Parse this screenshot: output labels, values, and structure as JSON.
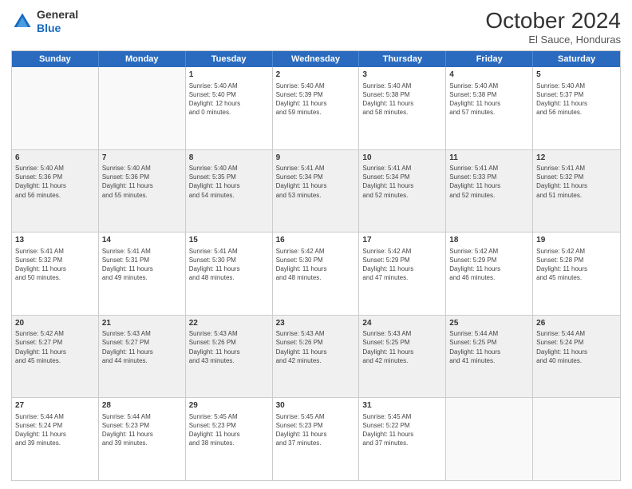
{
  "header": {
    "logo": {
      "general": "General",
      "blue": "Blue"
    },
    "month": "October 2024",
    "location": "El Sauce, Honduras"
  },
  "weekdays": [
    "Sunday",
    "Monday",
    "Tuesday",
    "Wednesday",
    "Thursday",
    "Friday",
    "Saturday"
  ],
  "rows": [
    [
      {
        "day": "",
        "info": "",
        "empty": true
      },
      {
        "day": "",
        "info": "",
        "empty": true
      },
      {
        "day": "1",
        "info": "Sunrise: 5:40 AM\nSunset: 5:40 PM\nDaylight: 12 hours\nand 0 minutes."
      },
      {
        "day": "2",
        "info": "Sunrise: 5:40 AM\nSunset: 5:39 PM\nDaylight: 11 hours\nand 59 minutes."
      },
      {
        "day": "3",
        "info": "Sunrise: 5:40 AM\nSunset: 5:38 PM\nDaylight: 11 hours\nand 58 minutes."
      },
      {
        "day": "4",
        "info": "Sunrise: 5:40 AM\nSunset: 5:38 PM\nDaylight: 11 hours\nand 57 minutes."
      },
      {
        "day": "5",
        "info": "Sunrise: 5:40 AM\nSunset: 5:37 PM\nDaylight: 11 hours\nand 56 minutes."
      }
    ],
    [
      {
        "day": "6",
        "info": "Sunrise: 5:40 AM\nSunset: 5:36 PM\nDaylight: 11 hours\nand 56 minutes.",
        "shaded": true
      },
      {
        "day": "7",
        "info": "Sunrise: 5:40 AM\nSunset: 5:36 PM\nDaylight: 11 hours\nand 55 minutes.",
        "shaded": true
      },
      {
        "day": "8",
        "info": "Sunrise: 5:40 AM\nSunset: 5:35 PM\nDaylight: 11 hours\nand 54 minutes.",
        "shaded": true
      },
      {
        "day": "9",
        "info": "Sunrise: 5:41 AM\nSunset: 5:34 PM\nDaylight: 11 hours\nand 53 minutes.",
        "shaded": true
      },
      {
        "day": "10",
        "info": "Sunrise: 5:41 AM\nSunset: 5:34 PM\nDaylight: 11 hours\nand 52 minutes.",
        "shaded": true
      },
      {
        "day": "11",
        "info": "Sunrise: 5:41 AM\nSunset: 5:33 PM\nDaylight: 11 hours\nand 52 minutes.",
        "shaded": true
      },
      {
        "day": "12",
        "info": "Sunrise: 5:41 AM\nSunset: 5:32 PM\nDaylight: 11 hours\nand 51 minutes.",
        "shaded": true
      }
    ],
    [
      {
        "day": "13",
        "info": "Sunrise: 5:41 AM\nSunset: 5:32 PM\nDaylight: 11 hours\nand 50 minutes."
      },
      {
        "day": "14",
        "info": "Sunrise: 5:41 AM\nSunset: 5:31 PM\nDaylight: 11 hours\nand 49 minutes."
      },
      {
        "day": "15",
        "info": "Sunrise: 5:41 AM\nSunset: 5:30 PM\nDaylight: 11 hours\nand 48 minutes."
      },
      {
        "day": "16",
        "info": "Sunrise: 5:42 AM\nSunset: 5:30 PM\nDaylight: 11 hours\nand 48 minutes."
      },
      {
        "day": "17",
        "info": "Sunrise: 5:42 AM\nSunset: 5:29 PM\nDaylight: 11 hours\nand 47 minutes."
      },
      {
        "day": "18",
        "info": "Sunrise: 5:42 AM\nSunset: 5:29 PM\nDaylight: 11 hours\nand 46 minutes."
      },
      {
        "day": "19",
        "info": "Sunrise: 5:42 AM\nSunset: 5:28 PM\nDaylight: 11 hours\nand 45 minutes."
      }
    ],
    [
      {
        "day": "20",
        "info": "Sunrise: 5:42 AM\nSunset: 5:27 PM\nDaylight: 11 hours\nand 45 minutes.",
        "shaded": true
      },
      {
        "day": "21",
        "info": "Sunrise: 5:43 AM\nSunset: 5:27 PM\nDaylight: 11 hours\nand 44 minutes.",
        "shaded": true
      },
      {
        "day": "22",
        "info": "Sunrise: 5:43 AM\nSunset: 5:26 PM\nDaylight: 11 hours\nand 43 minutes.",
        "shaded": true
      },
      {
        "day": "23",
        "info": "Sunrise: 5:43 AM\nSunset: 5:26 PM\nDaylight: 11 hours\nand 42 minutes.",
        "shaded": true
      },
      {
        "day": "24",
        "info": "Sunrise: 5:43 AM\nSunset: 5:25 PM\nDaylight: 11 hours\nand 42 minutes.",
        "shaded": true
      },
      {
        "day": "25",
        "info": "Sunrise: 5:44 AM\nSunset: 5:25 PM\nDaylight: 11 hours\nand 41 minutes.",
        "shaded": true
      },
      {
        "day": "26",
        "info": "Sunrise: 5:44 AM\nSunset: 5:24 PM\nDaylight: 11 hours\nand 40 minutes.",
        "shaded": true
      }
    ],
    [
      {
        "day": "27",
        "info": "Sunrise: 5:44 AM\nSunset: 5:24 PM\nDaylight: 11 hours\nand 39 minutes."
      },
      {
        "day": "28",
        "info": "Sunrise: 5:44 AM\nSunset: 5:23 PM\nDaylight: 11 hours\nand 39 minutes."
      },
      {
        "day": "29",
        "info": "Sunrise: 5:45 AM\nSunset: 5:23 PM\nDaylight: 11 hours\nand 38 minutes."
      },
      {
        "day": "30",
        "info": "Sunrise: 5:45 AM\nSunset: 5:23 PM\nDaylight: 11 hours\nand 37 minutes."
      },
      {
        "day": "31",
        "info": "Sunrise: 5:45 AM\nSunset: 5:22 PM\nDaylight: 11 hours\nand 37 minutes."
      },
      {
        "day": "",
        "info": "",
        "empty": true
      },
      {
        "day": "",
        "info": "",
        "empty": true
      }
    ]
  ]
}
